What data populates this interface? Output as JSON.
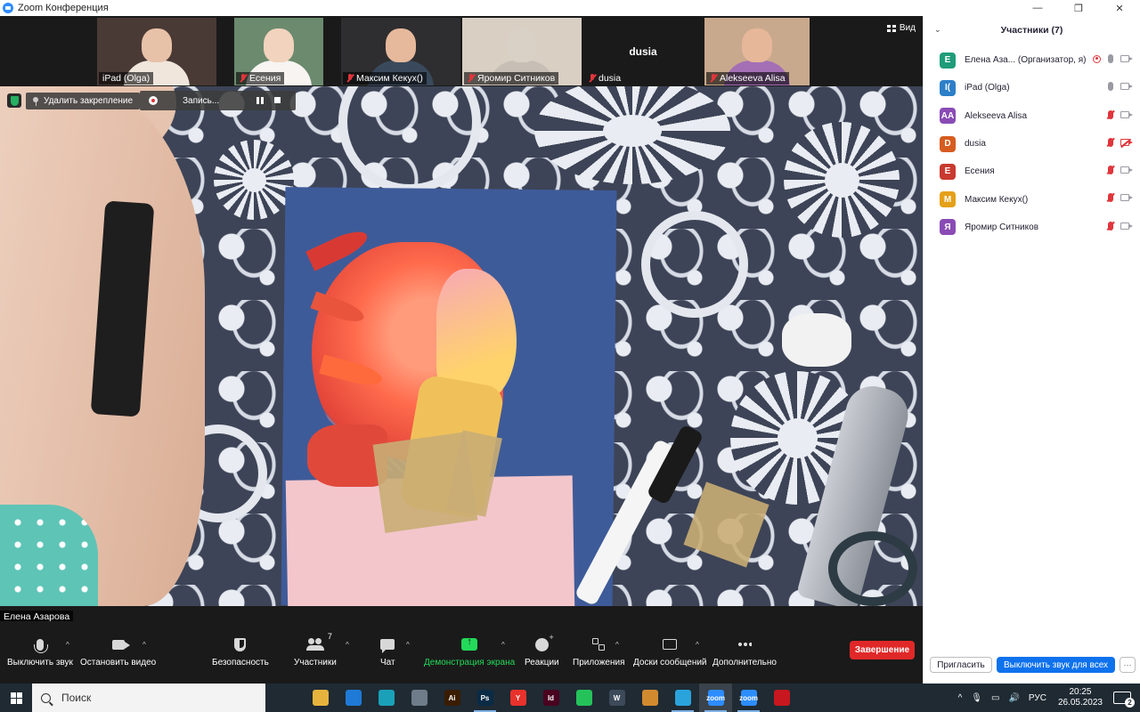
{
  "window": {
    "title": "Zoom Конференция",
    "minimize": "—",
    "restore": "❐",
    "close": "✕"
  },
  "strip": {
    "tiles": [
      {
        "name": "iPad (Olga)",
        "muted": false,
        "face": "#e8c2a8",
        "shirt": "#f0e6dc",
        "bg": "#4a3a35"
      },
      {
        "name": "Есения",
        "muted": true,
        "face": "#f2d3bd",
        "shirt": "#f7f4f1",
        "bg": "#6b8a6e"
      },
      {
        "name": "Максим Кекух()",
        "muted": true,
        "face": "#e6b99c",
        "shirt": "#3a4a5c",
        "bg": "#2e2e30"
      },
      {
        "name": "Яромир Ситников",
        "muted": true,
        "face": "#d9d0c6",
        "shirt": "#c7bfb5",
        "bg": "#d9cfc3"
      },
      {
        "name": "dusia",
        "muted": true,
        "big_name": "dusia"
      },
      {
        "name": "Alekseeva Alisa",
        "muted": true,
        "face": "#e7b79a",
        "shirt": "#a46fb5",
        "bg": "#c9a98d"
      }
    ],
    "view_label": "Вид"
  },
  "main": {
    "unpin_label": "Удалить закрепление",
    "recording_label": "Запись...",
    "speaker_name": "Елена Азарова"
  },
  "toolbar": {
    "mute": "Выключить звук",
    "stop_video": "Остановить видео",
    "security": "Безопасность",
    "participants": "Участники",
    "participants_count": "7",
    "chat": "Чат",
    "share": "Демонстрация экрана",
    "reactions": "Реакции",
    "apps": "Приложения",
    "whiteboards": "Доски сообщений",
    "more": "Дополнительно",
    "end": "Завершение",
    "caret": "^"
  },
  "panel": {
    "title": "Участники (7)",
    "collapse": "⌄",
    "participants": [
      {
        "initials": "Е",
        "name": "Елена Аза... (Организатор, я)",
        "color": "#1f9c7a",
        "mic_off": false,
        "cam_off": false,
        "recording": true
      },
      {
        "initials": "I(",
        "name": "iPad (Olga)",
        "color": "#2c7fc8",
        "mic_off": false,
        "cam_off": false,
        "recording": false
      },
      {
        "initials": "AA",
        "name": "Alekseeva Alisa",
        "color": "#8a4bb5",
        "mic_off": true,
        "cam_off": false,
        "recording": false
      },
      {
        "initials": "D",
        "name": "dusia",
        "color": "#d65c1f",
        "mic_off": true,
        "cam_off": true,
        "recording": false
      },
      {
        "initials": "Е",
        "name": "Есения",
        "color": "#c93a2f",
        "mic_off": true,
        "cam_off": false,
        "recording": false
      },
      {
        "initials": "М",
        "name": "Максим Кекух()",
        "color": "#e5a019",
        "mic_off": true,
        "cam_off": false,
        "recording": false
      },
      {
        "initials": "Я",
        "name": "Яромир Ситников",
        "color": "#8a4bb5",
        "mic_off": true,
        "cam_off": false,
        "recording": false
      }
    ],
    "invite": "Пригласить",
    "mute_all": "Выключить звук для всех",
    "more": "···"
  },
  "taskbar": {
    "search_placeholder": "Поиск",
    "apps": [
      {
        "label": "",
        "color": "#1f2a33",
        "icon": "task-view-icon",
        "running": false
      },
      {
        "label": "",
        "color": "#e6b43c",
        "icon": "folder-icon",
        "running": false
      },
      {
        "label": "",
        "color": "#1e7ad6",
        "icon": "mail-icon",
        "running": false
      },
      {
        "label": "",
        "color": "#1aa0b8",
        "icon": "edge-icon",
        "running": false
      },
      {
        "label": "",
        "color": "#6f7d8a",
        "icon": "calculator-icon",
        "running": false
      },
      {
        "label": "Ai",
        "color": "#3a1d00",
        "icon": "illustrator-icon",
        "running": false
      },
      {
        "label": "Ps",
        "color": "#0a2b45",
        "icon": "photoshop-icon",
        "running": true
      },
      {
        "label": "Y",
        "color": "#e8322b",
        "icon": "yandex-icon",
        "running": false
      },
      {
        "label": "Id",
        "color": "#49021f",
        "icon": "indesign-icon",
        "running": false
      },
      {
        "label": "",
        "color": "#25c25a",
        "icon": "whatsapp-icon",
        "running": false
      },
      {
        "label": "W",
        "color": "#3d4a5a",
        "icon": "word-icon",
        "running": false
      },
      {
        "label": "",
        "color": "#d28a2e",
        "icon": "drive-icon",
        "running": false
      },
      {
        "label": "",
        "color": "#2aa3dc",
        "icon": "telegram-icon",
        "running": true
      },
      {
        "label": "zoom",
        "color": "#2d8cff",
        "icon": "zoom-icon",
        "running": true,
        "active": true
      },
      {
        "label": "zoom",
        "color": "#2d8cff",
        "icon": "zoom-icon-2",
        "running": true
      },
      {
        "label": "",
        "color": "#c8171e",
        "icon": "acrobat-icon",
        "running": false
      }
    ],
    "tray_caret": "^",
    "lang": "РУС",
    "time": "20:25",
    "date": "26.05.2023",
    "notifications": "2"
  }
}
